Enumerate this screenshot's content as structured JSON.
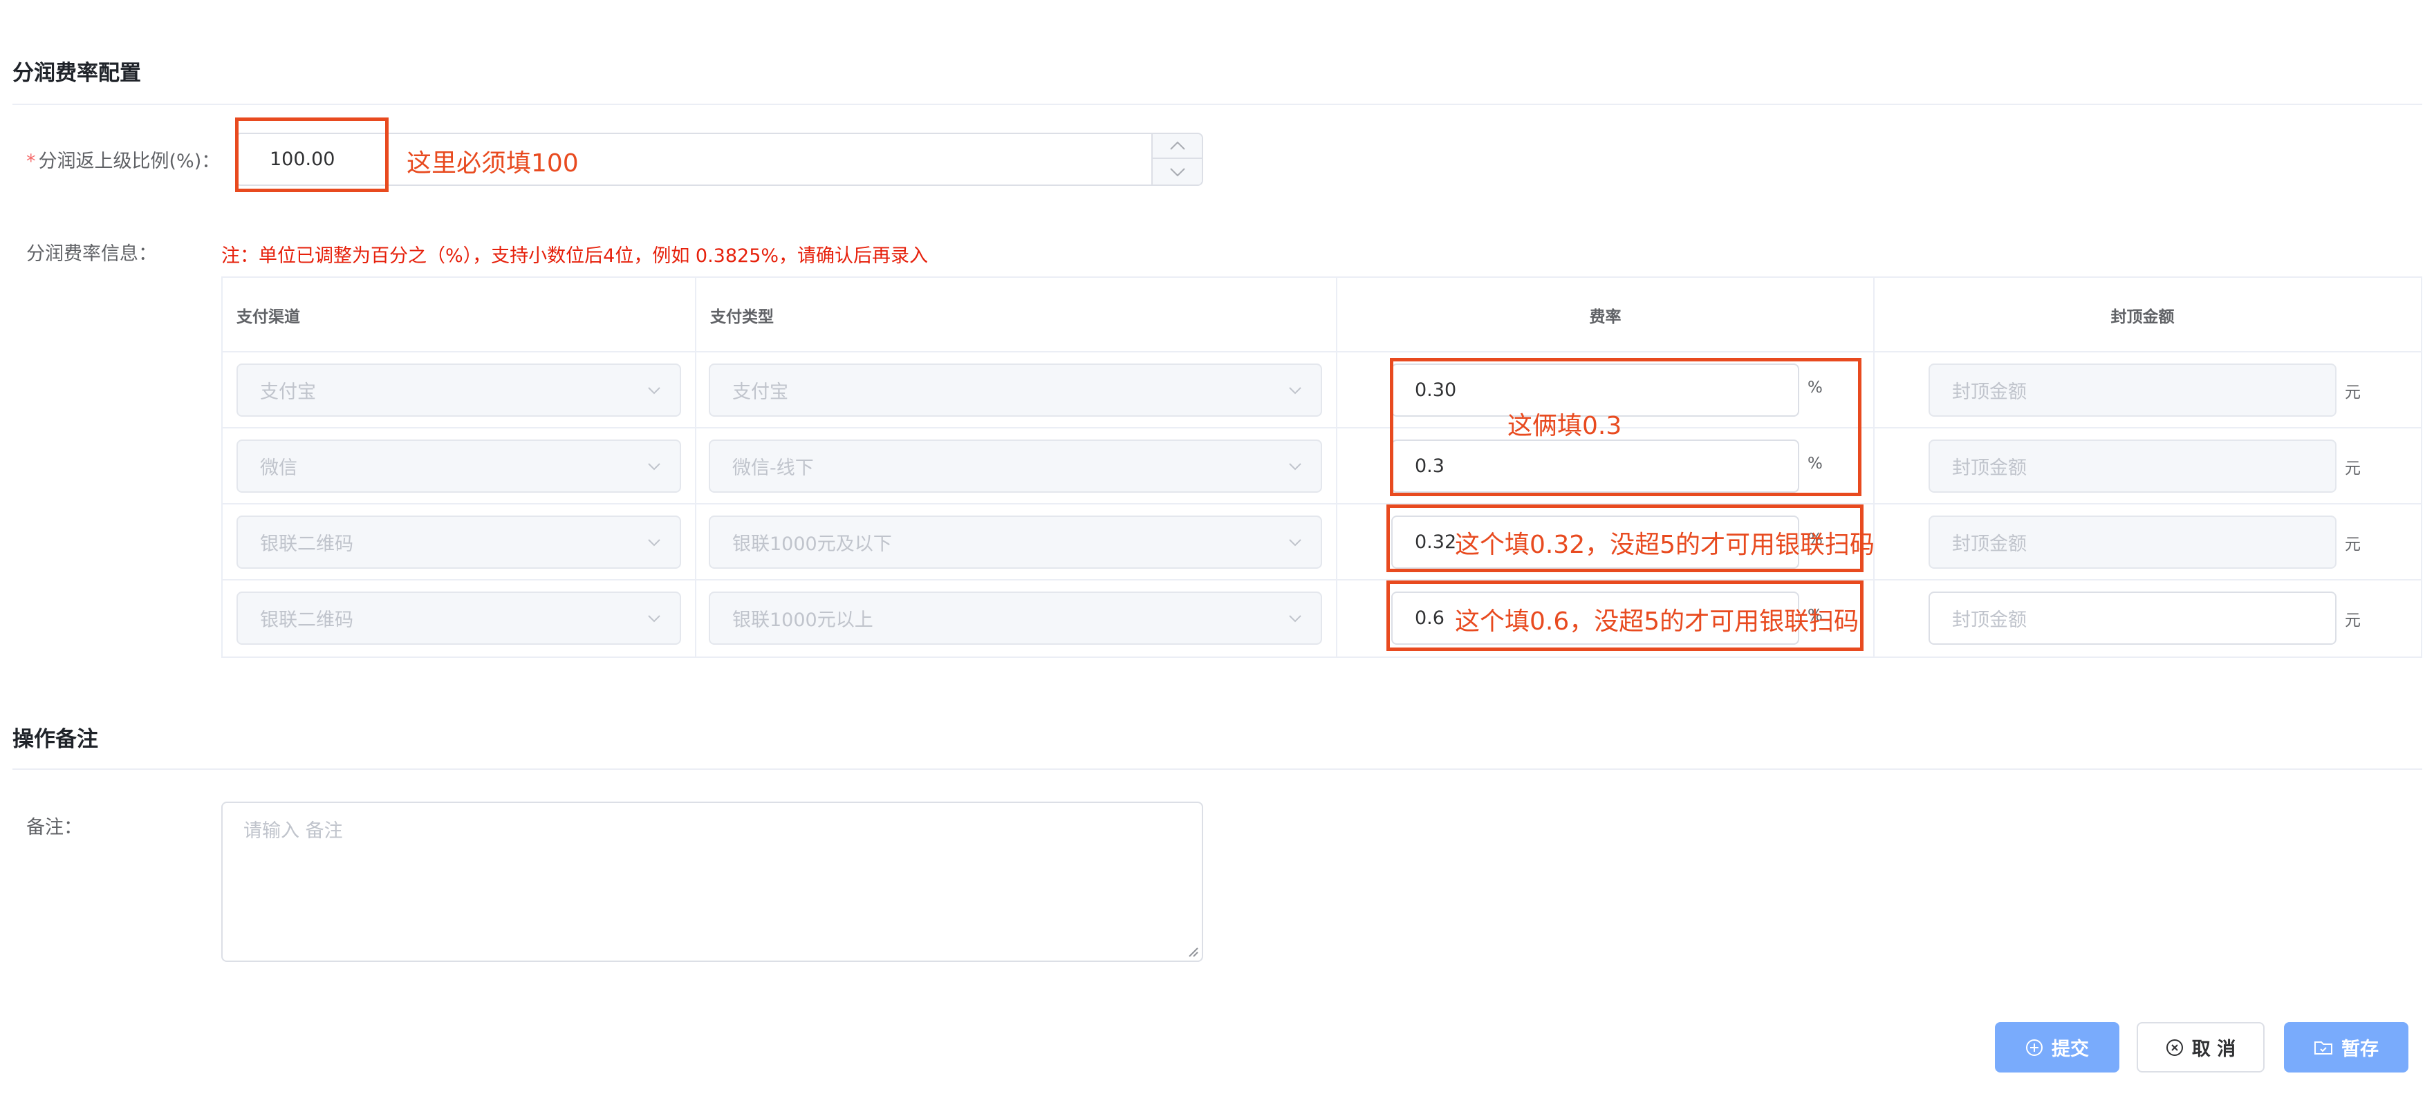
{
  "section1": {
    "title": "分润费率配置"
  },
  "ratio": {
    "label": "分润返上级比例(%)：",
    "required": "*",
    "value": "100.00"
  },
  "fee_info": {
    "label": "分润费率信息：",
    "note": "注：单位已调整为百分之（%），支持小数位后4位，例如 0.3825%，请确认后再录入"
  },
  "table": {
    "headers": [
      "支付渠道",
      "支付类型",
      "费率",
      "封顶金额"
    ],
    "rows": [
      {
        "channel": "支付宝",
        "type": "支付宝",
        "rate": "0.30",
        "rate_unit": "%",
        "cap_placeholder": "封顶金额",
        "cap_unit": "元"
      },
      {
        "channel": "微信",
        "type": "微信-线下",
        "rate": "0.3",
        "rate_unit": "%",
        "cap_placeholder": "封顶金额",
        "cap_unit": "元"
      },
      {
        "channel": "银联二维码",
        "type": "银联1000元及以下",
        "rate": "0.32",
        "rate_unit": "%",
        "cap_placeholder": "封顶金额",
        "cap_unit": "元"
      },
      {
        "channel": "银联二维码",
        "type": "银联1000元以上",
        "rate": "0.6",
        "rate_unit": "%",
        "cap_placeholder": "封顶金额",
        "cap_unit": "元"
      }
    ]
  },
  "annotations": {
    "ratio": "这里必须填100",
    "rows12": "这俩填0.3",
    "row3": "这个填0.32，没超5的才可用银联扫码",
    "row4": "这个填0.6，没超5的才可用银联扫码"
  },
  "section2": {
    "title": "操作备注"
  },
  "remark": {
    "label": "备注：",
    "placeholder": "请输入 备注"
  },
  "buttons": {
    "submit": "提交",
    "cancel": "取 消",
    "save": "暂存"
  },
  "colors": {
    "accent": "#79abfc",
    "annotation": "#e84a1f",
    "note": "#e6200b"
  }
}
